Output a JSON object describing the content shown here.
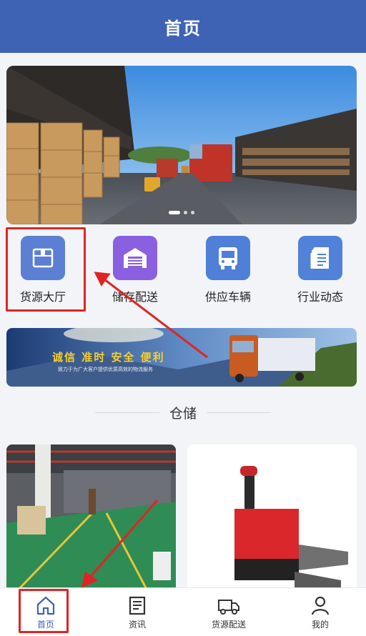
{
  "header": {
    "title": "首页"
  },
  "carousel": {
    "total": 3,
    "active_index": 0
  },
  "categories": [
    {
      "label": "货源大厅",
      "icon": "cargo-box-icon",
      "color": "#5b7fd3"
    },
    {
      "label": "储存配送",
      "icon": "warehouse-icon",
      "color": "#8a5fe0"
    },
    {
      "label": "供应车辆",
      "icon": "bus-icon",
      "color": "#4f7fd6"
    },
    {
      "label": "行业动态",
      "icon": "news-doc-icon",
      "color": "#4f82d8"
    }
  ],
  "promo": {
    "slogan": "诚信  准时  安全  便利",
    "subtitle": "致力于为广大客户提供优质高效的物流服务"
  },
  "section": {
    "title": "仓储"
  },
  "tabbar": [
    {
      "label": "首页",
      "icon": "home-icon",
      "active": true
    },
    {
      "label": "资讯",
      "icon": "news-icon",
      "active": false
    },
    {
      "label": "货源配送",
      "icon": "truck-icon",
      "active": false
    },
    {
      "label": "我的",
      "icon": "user-icon",
      "active": false
    }
  ],
  "colors": {
    "primary": "#3f63b4",
    "highlight": "#e02424",
    "background": "#f2f4f8"
  }
}
